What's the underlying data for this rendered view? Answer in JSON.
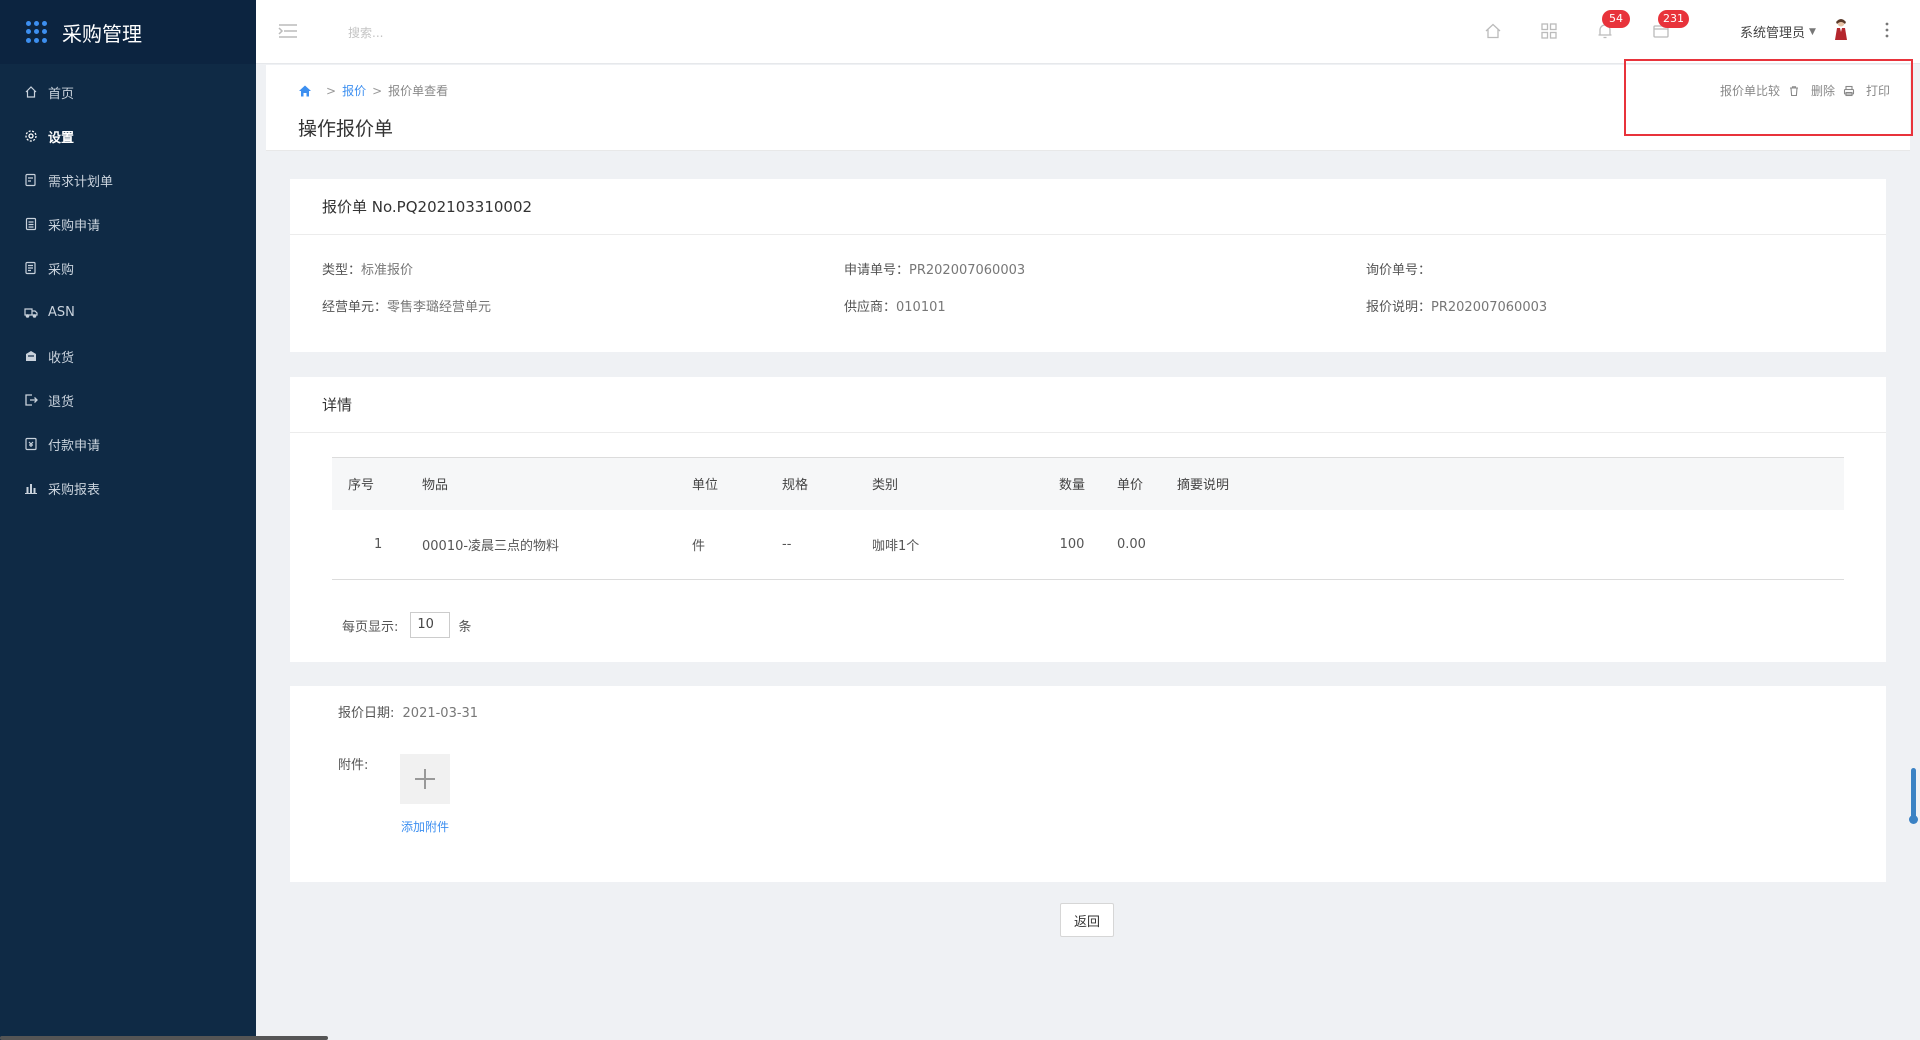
{
  "app": {
    "title": "采购管理"
  },
  "sidebar": {
    "items": [
      {
        "label": "首页",
        "icon": "home-icon"
      },
      {
        "label": "设置",
        "icon": "gear-icon",
        "active": true
      },
      {
        "label": "需求计划单",
        "icon": "document-edit-icon"
      },
      {
        "label": "采购申请",
        "icon": "clipboard-icon"
      },
      {
        "label": "采购",
        "icon": "list-document-icon"
      },
      {
        "label": "ASN",
        "icon": "truck-icon"
      },
      {
        "label": "收货",
        "icon": "inbox-icon"
      },
      {
        "label": "退货",
        "icon": "exit-icon"
      },
      {
        "label": "付款申请",
        "icon": "payment-icon"
      },
      {
        "label": "采购报表",
        "icon": "bar-chart-icon"
      }
    ]
  },
  "header": {
    "search_placeholder": "搜索...",
    "notification_count": "54",
    "message_count": "231",
    "user_name": "系统管理员"
  },
  "breadcrumb": {
    "link": "报价",
    "current": "报价单查看"
  },
  "page_title": "操作报价单",
  "actions": {
    "compare": "报价单比较",
    "delete": "删除",
    "print": "打印"
  },
  "quote": {
    "title": "报价单 No.PQ202103310002",
    "type_label": "类型：",
    "type_value": "标准报价",
    "request_label": "申请单号：",
    "request_value": "PR202007060003",
    "inquiry_label": "询价单号：",
    "inquiry_value": "",
    "unit_label": "经营单元：",
    "unit_value": "零售李璐经营单元",
    "supplier_label": "供应商：",
    "supplier_value": "010101",
    "desc_label": "报价说明：",
    "desc_value": "PR202007060003"
  },
  "detail": {
    "title": "详情",
    "columns": [
      "序号",
      "物品",
      "单位",
      "规格",
      "类别",
      "数量",
      "单价",
      "摘要说明"
    ],
    "rows": [
      [
        "1",
        "00010-凌晨三点的物料",
        "件",
        "--",
        "咖啡1个",
        "100",
        "0.00",
        ""
      ]
    ],
    "page_size_label": "每页显示:",
    "page_size": "10",
    "page_size_unit": "条"
  },
  "footer_info": {
    "date_label": "报价日期:",
    "date_value": "2021-03-31",
    "attachment_label": "附件:",
    "add_attachment": "添加附件"
  },
  "back_button": "返回",
  "colors": {
    "sidebar": "#0f2a45",
    "accent": "#3d8ff0",
    "badge": "#e8333b"
  }
}
